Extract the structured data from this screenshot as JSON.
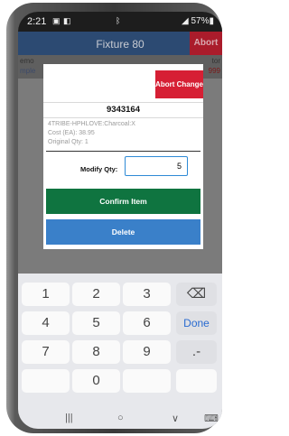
{
  "status": {
    "time": "2:21",
    "battery": "57%"
  },
  "appbar": {
    "title": "Fixture 80",
    "abort_short": "Abort"
  },
  "subbar": {
    "l1": "emo",
    "l2": "mple",
    "r1": "tor",
    "r2": "999"
  },
  "dialog": {
    "abort_label": "Abort Change",
    "sku": "9343164",
    "description": "4TRIBE-HPHLOVE:Charcoal:X",
    "cost": "Cost (EA): 38.95",
    "original_qty": "Original Qty: 1",
    "qty_label": "Modify Qty:",
    "qty_value": "5",
    "confirm_label": "Confirm Item",
    "delete_label": "Delete"
  },
  "keypad": {
    "k1": "1",
    "k2": "2",
    "k3": "3",
    "k4": "4",
    "k5": "5",
    "k6": "6",
    "k7": "7",
    "k8": "8",
    "k9": "9",
    "k0": "0",
    "backspace": "⌫",
    "done": "Done",
    "punct": ".-"
  },
  "navbar": {
    "recent": "|||",
    "home": "○",
    "back": "∨",
    "keyboard": "⌨"
  }
}
